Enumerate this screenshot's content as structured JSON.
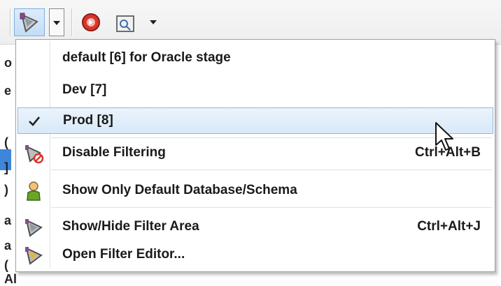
{
  "background_fragments": [
    "o",
    "e",
    "(",
    "]",
    ")",
    "a",
    "a",
    "(",
    "Al"
  ],
  "menu": {
    "items": [
      {
        "label": "default [6] for Oracle stage",
        "shortcut": "",
        "icon": "",
        "checked": false,
        "hot": false
      },
      {
        "label": "Dev [7]",
        "shortcut": "",
        "icon": "",
        "checked": false,
        "hot": false
      },
      {
        "label": "Prod [8]",
        "shortcut": "",
        "icon": "check-icon",
        "checked": true,
        "hot": true
      },
      {
        "label": "Disable Filtering",
        "shortcut": "Ctrl+Alt+B",
        "icon": "disable-filter-icon",
        "checked": false,
        "hot": false
      },
      {
        "label": "Show Only Default Database/Schema",
        "shortcut": "",
        "icon": "user-icon",
        "checked": false,
        "hot": false
      },
      {
        "label": "Show/Hide Filter Area",
        "shortcut": "Ctrl+Alt+J",
        "icon": "filter-icon",
        "checked": false,
        "hot": false
      },
      {
        "label": "Open Filter Editor...",
        "shortcut": "",
        "icon": "filter-edit-icon",
        "checked": false,
        "hot": false
      }
    ]
  },
  "toolbar": {
    "filter_button_icon": "filter-icon",
    "stop_button_icon": "stop-icon",
    "preview_button_icon": "magnifier-icon",
    "dropdown_icon": "chevron-down-icon"
  },
  "colors": {
    "hover_border": "#8fb8e0",
    "stop_red": "#d9362b",
    "user_green": "#6aa52a"
  }
}
